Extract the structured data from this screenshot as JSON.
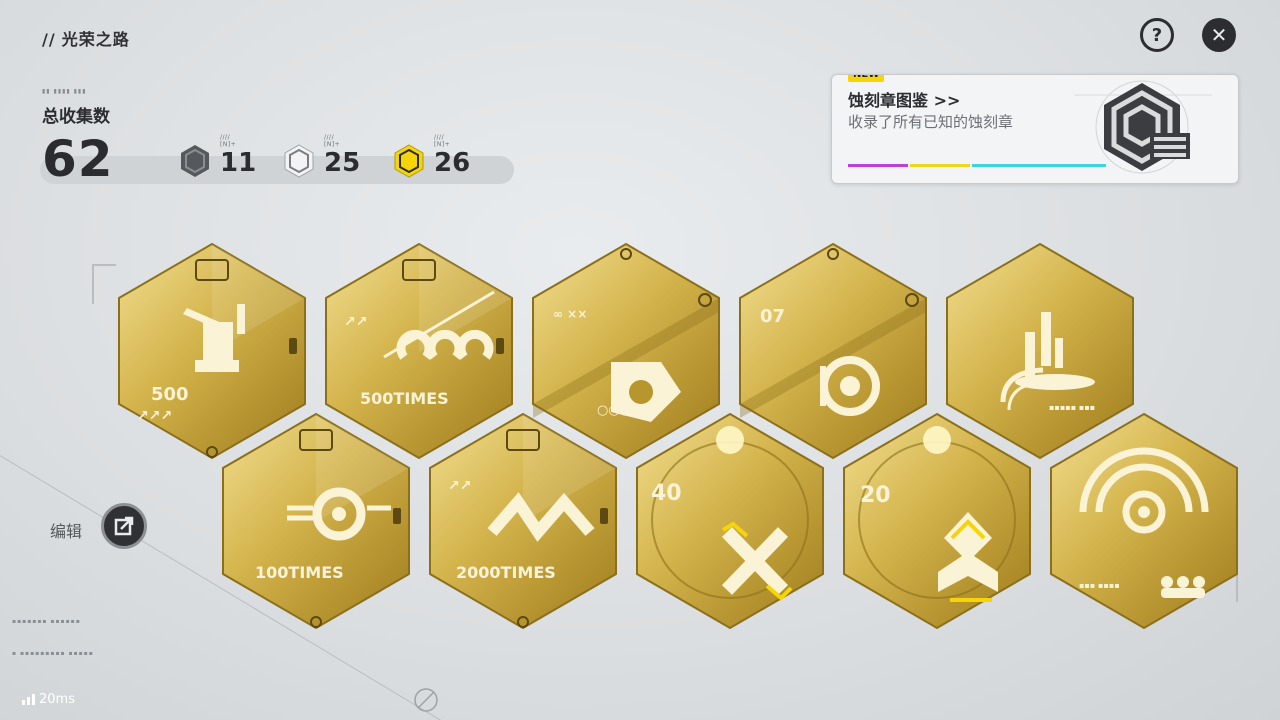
{
  "header": {
    "title": "光荣之路",
    "help_icon": "question-circle-icon",
    "close_icon": "close-x-icon"
  },
  "collection": {
    "label": "总收集数",
    "total": "62",
    "tiers": [
      {
        "name": "dark",
        "color": "#55585c",
        "count": "11"
      },
      {
        "name": "silver",
        "color": "#f2f3f4",
        "count": "25"
      },
      {
        "name": "gold",
        "color": "#f6d40a",
        "count": "26"
      }
    ]
  },
  "codex": {
    "badge": "NEW",
    "title": "蚀刻章图鉴 >>",
    "subtitle": "收录了所有已知的蚀刻章",
    "stripe_colors": [
      "#c23fd6",
      "#f0d818",
      "#38d6e0"
    ]
  },
  "badges": {
    "row1": [
      {
        "text": "500",
        "emblem": "robot"
      },
      {
        "text": "500TIMES",
        "emblem": "wave"
      },
      {
        "text": "",
        "emblem": "triangle-target"
      },
      {
        "text": "",
        "emblem": "level-disc"
      },
      {
        "text": "",
        "emblem": "pillar"
      }
    ],
    "row2": [
      {
        "text": "100TIMES",
        "emblem": "crosshair"
      },
      {
        "text": "2000TIMES",
        "emblem": "zigzag"
      },
      {
        "text": "40",
        "emblem": "crossed-swords"
      },
      {
        "text": "20",
        "emblem": "arrow-up"
      },
      {
        "text": "",
        "emblem": "signal-team"
      }
    ]
  },
  "edit": {
    "label": "编辑",
    "icon": "edit-arrow-icon"
  },
  "status": {
    "latency": "20ms"
  },
  "colors": {
    "gold_light": "#f0dc8c",
    "gold_mid": "#d4b248",
    "gold_dark": "#9c7a1c",
    "bg": "#dcdfe1"
  }
}
